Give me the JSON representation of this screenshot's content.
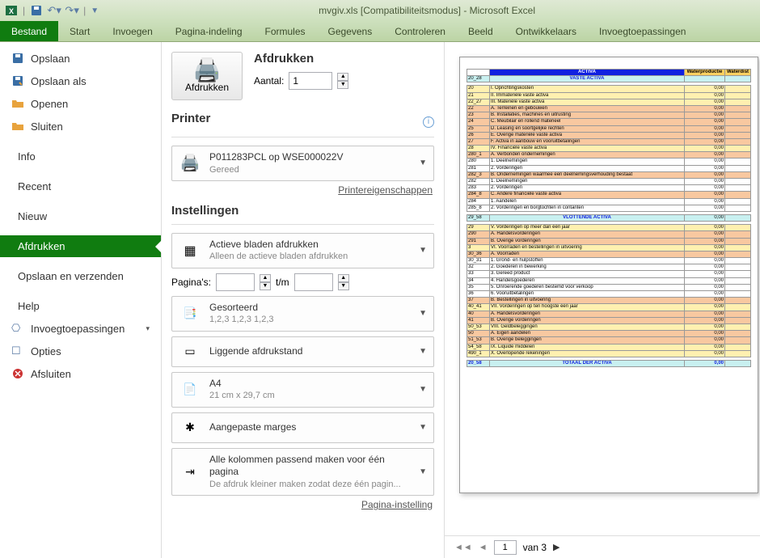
{
  "titlebar": {
    "title": "mvgiv.xls  [Compatibiliteitsmodus] - Microsoft Excel"
  },
  "ribbon": {
    "file": "Bestand",
    "tabs": [
      "Start",
      "Invoegen",
      "Pagina-indeling",
      "Formules",
      "Gegevens",
      "Controleren",
      "Beeld",
      "Ontwikkelaars",
      "Invoegtoepassingen"
    ]
  },
  "leftnav": {
    "save": "Opslaan",
    "saveas": "Opslaan als",
    "open": "Openen",
    "close": "Sluiten",
    "info": "Info",
    "recent": "Recent",
    "new": "Nieuw",
    "print": "Afdrukken",
    "saveSend": "Opslaan en verzenden",
    "help": "Help",
    "addins": "Invoegtoepassingen",
    "options": "Opties",
    "exit": "Afsluiten"
  },
  "print": {
    "title": "Afdrukken",
    "copiesLabel": "Aantal:",
    "copiesValue": "1",
    "buttonLabel": "Afdrukken",
    "printerTitle": "Printer",
    "printerName": "P011283PCL op WSE000022V",
    "printerStatus": "Gereed",
    "printerProps": "Printereigenschappen",
    "settingsTitle": "Instellingen",
    "activeSheets": "Actieve bladen afdrukken",
    "activeSheetsSub": "Alleen de actieve bladen afdrukken",
    "pagesLabel": "Pagina's:",
    "pagesFrom": "",
    "pagesToLabel": "t/m",
    "pagesTo": "",
    "collated": "Gesorteerd",
    "collatedSub": "1,2,3   1,2,3   1,2,3",
    "orientation": "Liggende afdrukstand",
    "paper": "A4",
    "paperSub": "21 cm x 29,7 cm",
    "margins": "Aangepaste marges",
    "scaling": "Alle kolommen passend maken voor één pagina",
    "scalingSub": "De afdruk kleiner maken zodat deze één pagin...",
    "pageSetup": "Pagina-instelling"
  },
  "preview": {
    "header": {
      "activa": "ACTIVA",
      "col1": "Waterproductie",
      "col2": "Waterdist"
    },
    "rows": [
      {
        "cls": "row-cyan",
        "code": "20_28",
        "desc": "VASTE ACTIVA",
        "v1": "",
        "v2": ""
      },
      {
        "cls": "gap-row",
        "code": "",
        "desc": "",
        "v1": "",
        "v2": ""
      },
      {
        "cls": "row-yellow",
        "code": "20",
        "desc": "I. Oprichtingskosten",
        "v1": "0,00",
        "v2": ""
      },
      {
        "cls": "row-yellow",
        "code": "21",
        "desc": "II. Immateriële vaste activa",
        "v1": "0,00",
        "v2": ""
      },
      {
        "cls": "row-yellow",
        "code": "22_27",
        "desc": "III. Materiële vaste activa",
        "v1": "0,00",
        "v2": ""
      },
      {
        "cls": "row-salmon",
        "code": "22",
        "desc": "A. Terreinen en gebouwen",
        "v1": "0,00",
        "v2": ""
      },
      {
        "cls": "row-salmon",
        "code": "23",
        "desc": "B. Installaties, machines en uitrusting",
        "v1": "0,00",
        "v2": ""
      },
      {
        "cls": "row-salmon",
        "code": "24",
        "desc": "C. Meubilair en rollend materieel",
        "v1": "0,00",
        "v2": ""
      },
      {
        "cls": "row-salmon",
        "code": "25",
        "desc": "D. Leasing en soortgelijke rechten",
        "v1": "0,00",
        "v2": ""
      },
      {
        "cls": "row-salmon",
        "code": "26",
        "desc": "E. Overige materiële vaste activa",
        "v1": "0,00",
        "v2": ""
      },
      {
        "cls": "row-salmon",
        "code": "27",
        "desc": "F. Activa in aanbouw en vooruitbetalingen",
        "v1": "0,00",
        "v2": ""
      },
      {
        "cls": "row-yellow",
        "code": "28",
        "desc": "IV. Financiële vaste activa",
        "v1": "0,00",
        "v2": ""
      },
      {
        "cls": "row-salmon",
        "code": "280_1",
        "desc": "A. Verbonden ondernemingen",
        "v1": "0,00",
        "v2": ""
      },
      {
        "cls": "row-white",
        "code": "280",
        "desc": "1. Deelnemingen",
        "v1": "0,00",
        "v2": ""
      },
      {
        "cls": "row-white",
        "code": "281",
        "desc": "2. Vorderingen",
        "v1": "0,00",
        "v2": ""
      },
      {
        "cls": "row-salmon",
        "code": "282_3",
        "desc": "B. Ondernemingen waarmee een deelnemingsverhouding bestaat",
        "v1": "0,00",
        "v2": ""
      },
      {
        "cls": "row-white",
        "code": "282",
        "desc": "1. Deelnemingen",
        "v1": "0,00",
        "v2": ""
      },
      {
        "cls": "row-white",
        "code": "283",
        "desc": "2. Vorderingen",
        "v1": "0,00",
        "v2": ""
      },
      {
        "cls": "row-salmon",
        "code": "284_8",
        "desc": "C. Andere financiële vaste activa",
        "v1": "0,00",
        "v2": ""
      },
      {
        "cls": "row-white",
        "code": "284",
        "desc": "1. Aandelen",
        "v1": "0,00",
        "v2": ""
      },
      {
        "cls": "row-white",
        "code": "285_8",
        "desc": "2. Vorderingen en borgtochten in contanten",
        "v1": "0,00",
        "v2": ""
      },
      {
        "cls": "gap-row",
        "code": "",
        "desc": "",
        "v1": "",
        "v2": ""
      },
      {
        "cls": "row-cyan",
        "code": "29_58",
        "desc": "VLOTTENDE ACTIVA",
        "v1": "0,00",
        "v2": ""
      },
      {
        "cls": "gap-row",
        "code": "",
        "desc": "",
        "v1": "",
        "v2": ""
      },
      {
        "cls": "row-yellow",
        "code": "29",
        "desc": "V. Vorderingen op meer dan één jaar",
        "v1": "0,00",
        "v2": ""
      },
      {
        "cls": "row-salmon",
        "code": "290",
        "desc": "A. Handelsvorderingen",
        "v1": "0,00",
        "v2": ""
      },
      {
        "cls": "row-salmon",
        "code": "291",
        "desc": "B. Overige vorderingen",
        "v1": "0,00",
        "v2": ""
      },
      {
        "cls": "row-yellow",
        "code": "3",
        "desc": "VI. Voorraden en bestellingen in uitvoering",
        "v1": "0,00",
        "v2": ""
      },
      {
        "cls": "row-salmon",
        "code": "30_36",
        "desc": "A. Voorraden",
        "v1": "0,00",
        "v2": ""
      },
      {
        "cls": "row-white",
        "code": "30_31",
        "desc": "1. Grond- en hulpstoffen",
        "v1": "0,00",
        "v2": ""
      },
      {
        "cls": "row-white",
        "code": "32",
        "desc": "2. Goederen in bewerking",
        "v1": "0,00",
        "v2": ""
      },
      {
        "cls": "row-white",
        "code": "33",
        "desc": "3. Gereed product",
        "v1": "0,00",
        "v2": ""
      },
      {
        "cls": "row-white",
        "code": "34",
        "desc": "4. Handelsgoederen",
        "v1": "0,00",
        "v2": ""
      },
      {
        "cls": "row-white",
        "code": "35",
        "desc": "5. Onroerende goederen bestemd voor verkoop",
        "v1": "0,00",
        "v2": ""
      },
      {
        "cls": "row-white",
        "code": "36",
        "desc": "6. Vooruitbetalingen",
        "v1": "0,00",
        "v2": ""
      },
      {
        "cls": "row-salmon",
        "code": "37",
        "desc": "B. Bestellingen in uitvoering",
        "v1": "0,00",
        "v2": ""
      },
      {
        "cls": "row-yellow",
        "code": "40_41",
        "desc": "VII. Vorderingen op ten hoogste één jaar",
        "v1": "0,00",
        "v2": ""
      },
      {
        "cls": "row-salmon",
        "code": "40",
        "desc": "A. Handelsvorderingen",
        "v1": "0,00",
        "v2": ""
      },
      {
        "cls": "row-salmon",
        "code": "41",
        "desc": "B. Overige vorderingen",
        "v1": "0,00",
        "v2": ""
      },
      {
        "cls": "row-yellow",
        "code": "50_53",
        "desc": "VIII. Geldbeleggingen",
        "v1": "0,00",
        "v2": ""
      },
      {
        "cls": "row-salmon",
        "code": "50",
        "desc": "A. Eigen aandelen",
        "v1": "0,00",
        "v2": ""
      },
      {
        "cls": "row-salmon",
        "code": "51_53",
        "desc": "B. Overige beleggingen",
        "v1": "0,00",
        "v2": ""
      },
      {
        "cls": "row-yellow",
        "code": "54_58",
        "desc": "IX. Liquide middelen",
        "v1": "0,00",
        "v2": ""
      },
      {
        "cls": "row-yellow",
        "code": "490_1",
        "desc": "X. Overlopende rekeningen",
        "v1": "0,00",
        "v2": ""
      },
      {
        "cls": "gap-row",
        "code": "",
        "desc": "",
        "v1": "",
        "v2": ""
      },
      {
        "cls": "row-total",
        "code": "20_58",
        "desc": "TOTAAL DER ACTIVA",
        "v1": "0,00",
        "v2": ""
      }
    ]
  },
  "pager": {
    "current": "1",
    "of": "van 3"
  }
}
